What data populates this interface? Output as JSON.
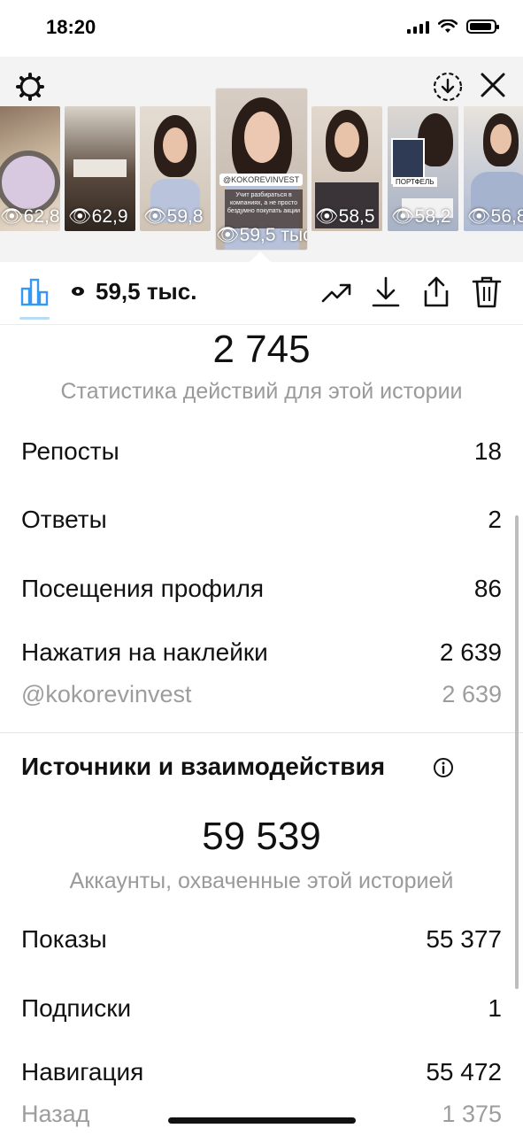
{
  "status": {
    "time": "18:20"
  },
  "thumbnails": [
    {
      "views": "62,8"
    },
    {
      "views": "62,9"
    },
    {
      "views": "59,8"
    },
    {
      "views": "59,5 тыс.",
      "tag": "@KOKOREVINVEST",
      "caption": "Учит разбираться в компаниях, а не просто бездумно покупать акции"
    },
    {
      "views": "58,5"
    },
    {
      "views": "58,2",
      "tag": "ПОРТФЕЛЬ"
    },
    {
      "views": "56,8"
    }
  ],
  "header": {
    "views_total": "59,5 тыс."
  },
  "actions_section": {
    "total": "2 745",
    "caption": "Статистика действий для этой истории",
    "rows": [
      {
        "label": "Репосты",
        "value": "18"
      },
      {
        "label": "Ответы",
        "value": "2"
      },
      {
        "label": "Посещения профиля",
        "value": "86"
      },
      {
        "label": "Нажатия на наклейки",
        "value": "2 639"
      },
      {
        "label": "@kokorevinvest",
        "value": "2 639"
      }
    ]
  },
  "sources_section": {
    "title": "Источники и взаимодействия",
    "total": "59 539",
    "caption": "Аккаунты, охваченные этой историей",
    "rows": [
      {
        "label": "Показы",
        "value": "55 377"
      },
      {
        "label": "Подписки",
        "value": "1"
      },
      {
        "label": "Навигация",
        "value": "55 472"
      },
      {
        "label": "Назад",
        "value": "1 375"
      }
    ]
  },
  "colors": {
    "accent": "#3897f0",
    "muted_text": "#9a9a9a",
    "top_bg": "#f3f3f3"
  }
}
